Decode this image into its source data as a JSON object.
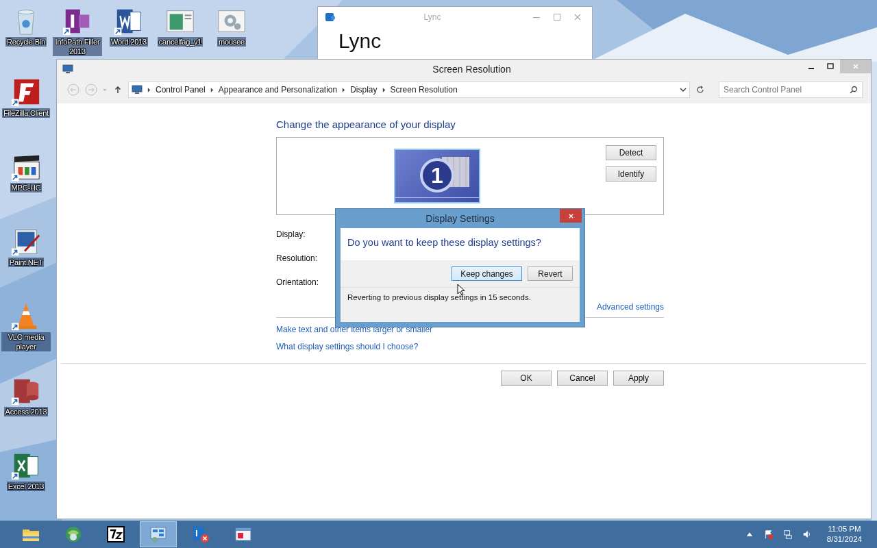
{
  "desktop_icons": [
    {
      "label": "Recycle Bin",
      "kind": "recycle"
    },
    {
      "label": "InfoPath Filler 2013",
      "kind": "infopath"
    },
    {
      "label": "Word 2013",
      "kind": "word"
    },
    {
      "label": "cancelfag_v1",
      "kind": "doc"
    },
    {
      "label": "mousee",
      "kind": "gears"
    },
    {
      "label": "FileZilla Client",
      "kind": "filezilla"
    },
    {
      "label": "MPC-HC",
      "kind": "clapper"
    },
    {
      "label": "Paint.NET",
      "kind": "paint"
    },
    {
      "label": "VLC media player",
      "kind": "cone"
    },
    {
      "label": "Access 2013",
      "kind": "access"
    },
    {
      "label": "Excel 2013",
      "kind": "excel"
    }
  ],
  "background_window": {
    "title": "Lync",
    "logo": "Lync"
  },
  "window": {
    "title": "Screen Resolution",
    "breadcrumb": [
      "Control Panel",
      "Appearance and Personalization",
      "Display",
      "Screen Resolution"
    ],
    "search": {
      "placeholder": "Search Control Panel"
    },
    "heading": "Change the appearance of your display",
    "monitor_number": "1",
    "side_buttons": [
      "Detect",
      "Identify"
    ],
    "fields": [
      "Display:",
      "Resolution:",
      "Orientation:"
    ],
    "advanced_link": "Advanced settings",
    "links": [
      "Make text and other items larger or smaller",
      "What display settings should I choose?"
    ],
    "footer_buttons": [
      "OK",
      "Cancel",
      "Apply"
    ]
  },
  "dialog": {
    "title": "Display Settings",
    "question": "Do you want to keep these display settings?",
    "buttons": [
      {
        "label": "Keep changes",
        "focused": true
      },
      {
        "label": "Revert",
        "focused": false
      }
    ],
    "countdown": "Reverting to previous display settings in 15 seconds."
  },
  "taskbar": {
    "items": [
      {
        "kind": "folder",
        "selected": false
      },
      {
        "kind": "globe",
        "selected": false
      },
      {
        "kind": "sevenzip",
        "selected": false
      },
      {
        "kind": "control",
        "selected": true
      },
      {
        "kind": "lync",
        "selected": false
      },
      {
        "kind": "dialog",
        "selected": false
      }
    ],
    "time": "11:05 PM",
    "date": "8/31/2024"
  }
}
